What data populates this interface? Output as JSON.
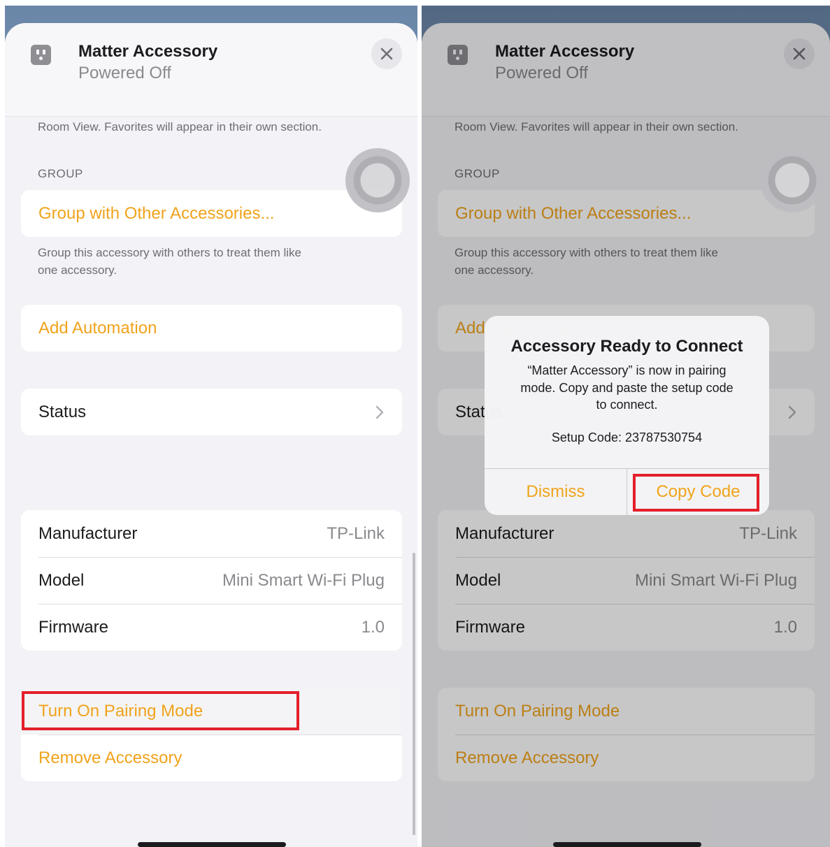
{
  "header": {
    "title": "Matter Accessory",
    "subtitle": "Powered Off"
  },
  "favorites_caption": "Room View. Favorites will appear in their own section.",
  "group": {
    "section_label": "GROUP",
    "action": "Group with Other Accessories...",
    "caption_line1": "Group this accessory with others to treat them like",
    "caption_line2": "one accessory."
  },
  "automation": {
    "action": "Add Automation"
  },
  "status": {
    "label": "Status"
  },
  "info": [
    {
      "label": "Manufacturer",
      "value": "TP-Link"
    },
    {
      "label": "Model",
      "value": "Mini Smart Wi-Fi Plug"
    },
    {
      "label": "Firmware",
      "value": "1.0"
    }
  ],
  "actions": {
    "pairing": "Turn On Pairing Mode",
    "remove": "Remove Accessory"
  },
  "alert": {
    "title": "Accessory Ready to Connect",
    "message_line1": "“Matter Accessory” is now in pairing",
    "message_line2": "mode. Copy and paste the setup code",
    "message_line3": "to connect.",
    "setup_code": "Setup Code: 23787530754",
    "dismiss": "Dismiss",
    "copy": "Copy Code"
  },
  "colors": {
    "accent": "#f0a31c",
    "highlight": "#e3202b"
  },
  "icons": {
    "accessory": "power-outlet-icon",
    "close": "close-icon",
    "status": "chevron-right-icon"
  }
}
